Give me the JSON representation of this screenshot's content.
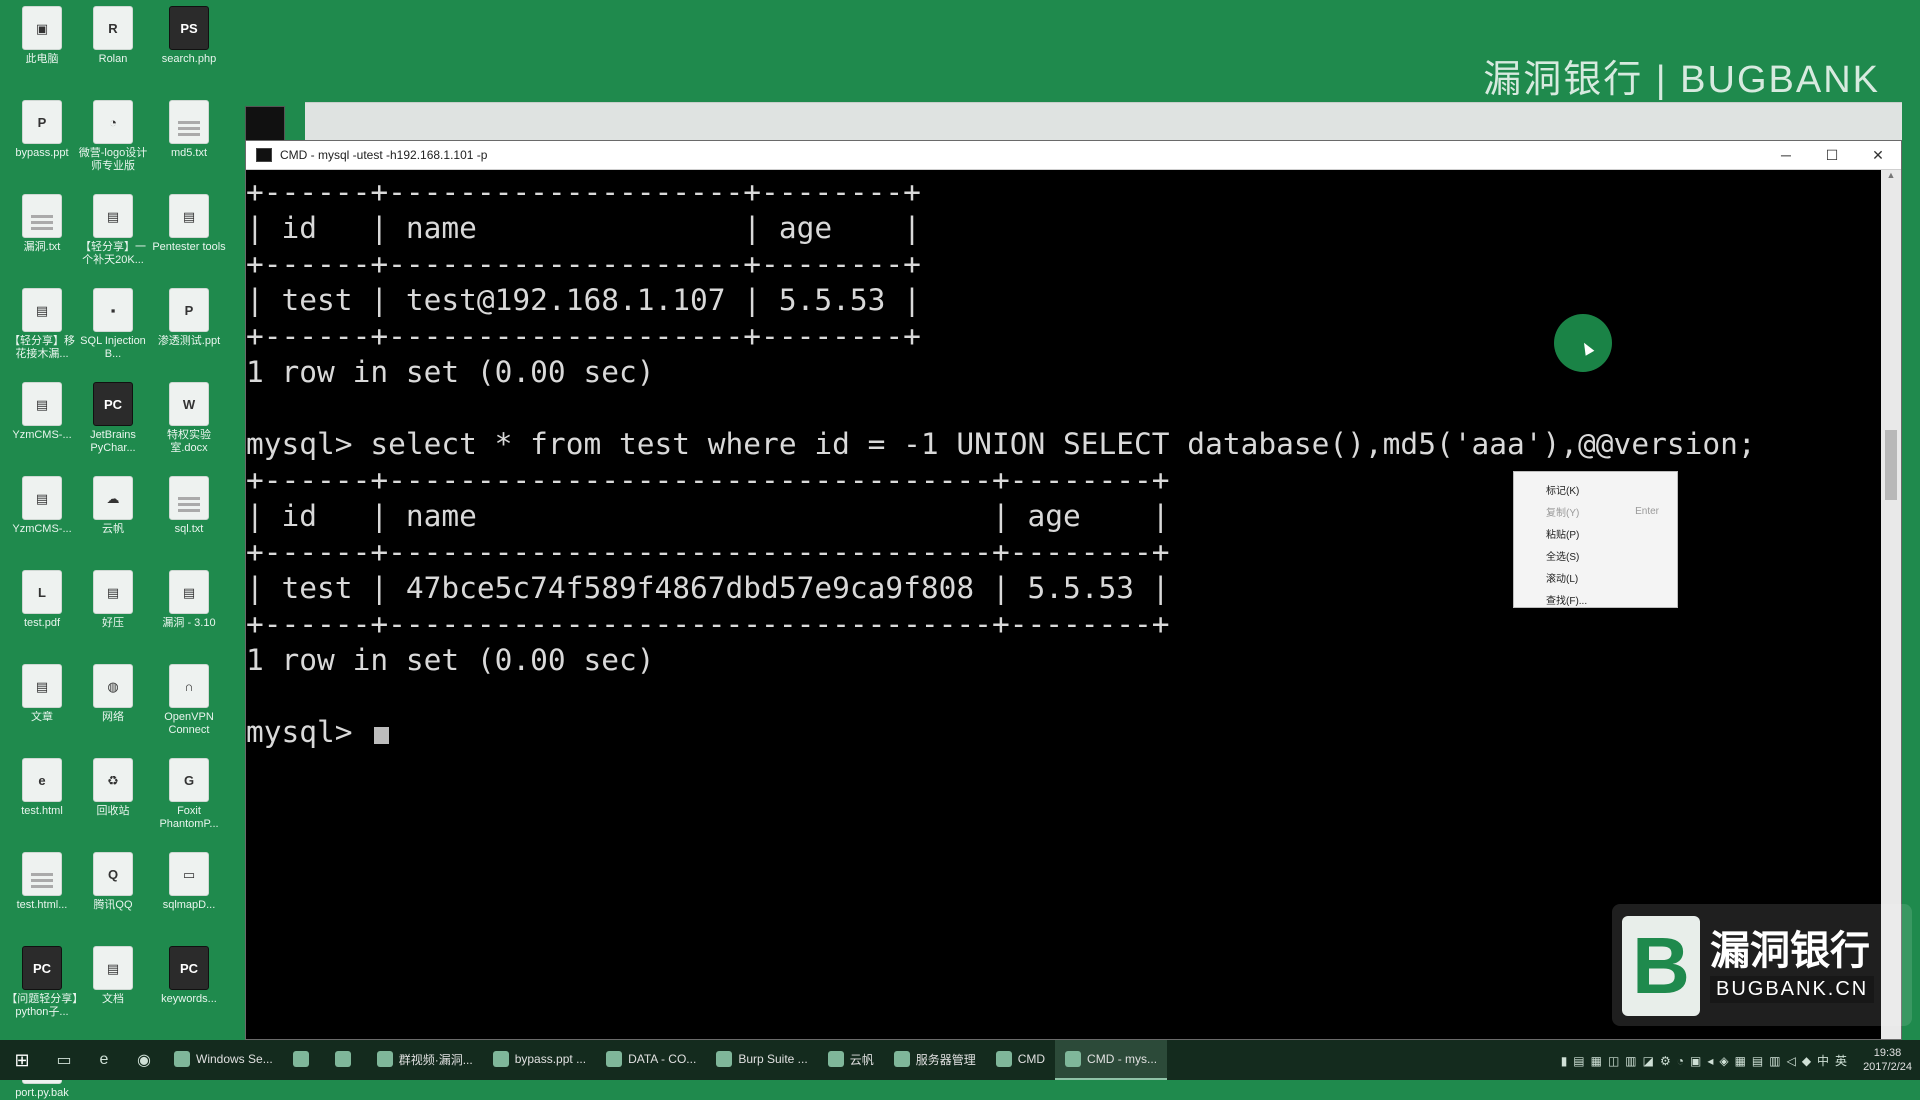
{
  "desktop": {
    "icons": [
      {
        "label": "此电脑",
        "glyph": "▣"
      },
      {
        "label": "Rolan",
        "glyph": "R"
      },
      {
        "label": "search.php",
        "glyph": "PS"
      },
      {
        "label": "bypass.ppt",
        "glyph": "P"
      },
      {
        "label": "微营-logo设计师专业版",
        "glyph": "◔"
      },
      {
        "label": "md5.txt",
        "glyph": ""
      },
      {
        "label": "漏洞.txt",
        "glyph": ""
      },
      {
        "label": "【轻分享】一个补天20K...",
        "glyph": "▤"
      },
      {
        "label": "Pentester tools",
        "glyph": "▤"
      },
      {
        "label": "【轻分享】移花接木漏...",
        "glyph": "▤"
      },
      {
        "label": "SQL Injection B...",
        "glyph": "▪"
      },
      {
        "label": "渗透测试.ppt",
        "glyph": "P"
      },
      {
        "label": "YzmCMS-...",
        "glyph": "▤"
      },
      {
        "label": "JetBrains PyChar...",
        "glyph": "PC"
      },
      {
        "label": "特权实验室.docx",
        "glyph": "W"
      },
      {
        "label": "YzmCMS-...",
        "glyph": "▤"
      },
      {
        "label": "云帆",
        "glyph": "☁"
      },
      {
        "label": "sql.txt",
        "glyph": ""
      },
      {
        "label": "test.pdf",
        "glyph": "L"
      },
      {
        "label": "好压",
        "glyph": "▤"
      },
      {
        "label": "漏洞 - 3.10",
        "glyph": "▤"
      },
      {
        "label": "文章",
        "glyph": "▤"
      },
      {
        "label": "网络",
        "glyph": "◍"
      },
      {
        "label": "OpenVPN Connect",
        "glyph": "∩"
      },
      {
        "label": "test.html",
        "glyph": "e"
      },
      {
        "label": "回收站",
        "glyph": "♻"
      },
      {
        "label": "Foxit PhantomP...",
        "glyph": "G"
      },
      {
        "label": "test.html...",
        "glyph": ""
      },
      {
        "label": "腾讯QQ",
        "glyph": "Q"
      },
      {
        "label": "sqlmapD...",
        "glyph": "▭"
      },
      {
        "label": "【问题轻分享】python子...",
        "glyph": "PC"
      },
      {
        "label": "文档",
        "glyph": "▤"
      },
      {
        "label": "keywords...",
        "glyph": "PC"
      },
      {
        "label": "port.py.bak",
        "glyph": ""
      }
    ]
  },
  "watermark": {
    "top": "漏洞银行 | BUGBANK"
  },
  "cmd": {
    "title": "CMD - mysql  -utest -h192.168.1.101 -p",
    "controls": {
      "minimize": "─",
      "maximize": "☐",
      "close": "✕"
    },
    "lines": [
      "+------+--------------------+--------+",
      "| id   | name               | age    |",
      "+------+--------------------+--------+",
      "| test | test@192.168.1.107 | 5.5.53 |",
      "+------+--------------------+--------+",
      "1 row in set (0.00 sec)",
      "",
      "mysql> select * from test where id = -1 UNION SELECT database(),md5('aaa'),@@version;",
      "+------+----------------------------------+--------+",
      "| id   | name                             | age    |",
      "+------+----------------------------------+--------+",
      "| test | 47bce5c74f589f4867dbd57e9ca9f808 | 5.5.53 |",
      "+------+----------------------------------+--------+",
      "1 row in set (0.00 sec)",
      ""
    ],
    "prompt": "mysql> "
  },
  "context_menu": {
    "items": [
      {
        "label": "标记(K)",
        "shortcut": "",
        "enabled": true
      },
      {
        "label": "复制(Y)",
        "shortcut": "Enter",
        "enabled": false
      },
      {
        "label": "粘贴(P)",
        "shortcut": "",
        "enabled": true
      },
      {
        "label": "全选(S)",
        "shortcut": "",
        "enabled": true
      },
      {
        "label": "滚动(L)",
        "shortcut": "",
        "enabled": true
      },
      {
        "label": "查找(F)...",
        "shortcut": "",
        "enabled": true
      }
    ]
  },
  "brand": {
    "cn": "漏洞银行",
    "en": "BUGBANK.CN",
    "mark": "B"
  },
  "taskbar": {
    "start": "⊞",
    "pinned": [
      "▭",
      "e",
      "◉"
    ],
    "items": [
      {
        "label": "Windows Se...",
        "active": false
      },
      {
        "label": "",
        "active": false
      },
      {
        "label": "",
        "active": false
      },
      {
        "label": "群视频·漏洞...",
        "active": false
      },
      {
        "label": "bypass.ppt ...",
        "active": false
      },
      {
        "label": "DATA - CO...",
        "active": false
      },
      {
        "label": "Burp Suite ...",
        "active": false
      },
      {
        "label": "云帆",
        "active": false
      },
      {
        "label": "服务器管理",
        "active": false
      },
      {
        "label": "CMD",
        "active": false
      },
      {
        "label": "CMD - mys...",
        "active": true
      }
    ],
    "tray_icons": "▮▤▦◫▥◪⚙◔▣◂◈▦▤▥◁◆中英",
    "time": "19:38",
    "date": "2017/2/24"
  },
  "colors": {
    "desktop": "#1f8a4d",
    "terminal_bg": "#000000",
    "terminal_fg": "#d9d9d9",
    "taskbar": "#142b1e"
  }
}
